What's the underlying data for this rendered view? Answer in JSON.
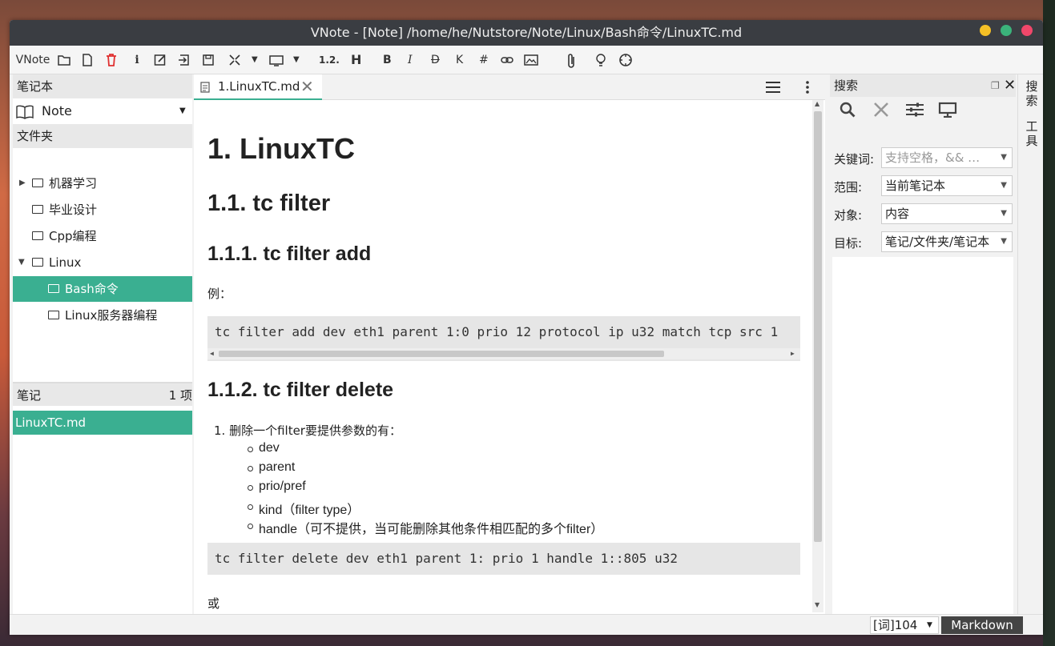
{
  "window": {
    "title": "VNote - [Note] /home/he/Nutstore/Note/Linux/Bash命令/LinuxTC.md"
  },
  "toolbar": {
    "app_label": "VNote",
    "heading_seq_label": "1.2.",
    "heading_label": "H",
    "bold_label": "B",
    "italic_label": "I",
    "strike_label": "D",
    "code_label": "K",
    "hash_label": "#"
  },
  "left": {
    "notebook_header": "笔记本",
    "notebook_name": "Note",
    "folder_header": "文件夹",
    "folders": [
      {
        "label": "机器学习"
      },
      {
        "label": "毕业设计"
      },
      {
        "label": "Cpp编程"
      },
      {
        "label": "Linux"
      },
      {
        "label": "Bash命令"
      },
      {
        "label": "Linux服务器编程"
      }
    ],
    "notes_header": "笔记",
    "notes_count": "1 项",
    "notes": [
      {
        "label": "LinuxTC.md"
      }
    ]
  },
  "editor": {
    "tab_label": "1.LinuxTC.md",
    "h1": "1. LinuxTC",
    "h2": "1.1. tc filter",
    "h3a": "1.1.1. tc filter add",
    "p_example": "例：",
    "code1": "tc filter add dev eth1 parent 1:0 prio 12 protocol ip u32  match tcp src 1",
    "h3b": "1.1.2. tc filter delete",
    "ol_item": "1. 删除一个filter要提供参数的有：",
    "bullets": [
      "dev",
      "parent",
      "prio/pref",
      "kind（filter type）",
      "handle（可不提供，当可能删除其他条件相匹配的多个filter）"
    ],
    "code2": "tc filter delete dev eth1 parent 1: prio 1 handle 1::805 u32",
    "p_or": "或"
  },
  "search": {
    "header": "搜索",
    "keyword_label": "关键词:",
    "keyword_placeholder": "支持空格，&& …",
    "scope_label": "范围:",
    "scope_value": "当前笔记本",
    "object_label": "对象:",
    "object_value": "内容",
    "target_label": "目标:",
    "target_value": "笔记/文件夹/笔记本"
  },
  "side_tabs": {
    "search": "搜索",
    "tools": "工具"
  },
  "status": {
    "word_count": "[词]104",
    "mode": "Markdown"
  },
  "colors": {
    "accent": "#3aaf91",
    "titlebar": "#3a3d42",
    "delete_icon": "#e03030"
  }
}
